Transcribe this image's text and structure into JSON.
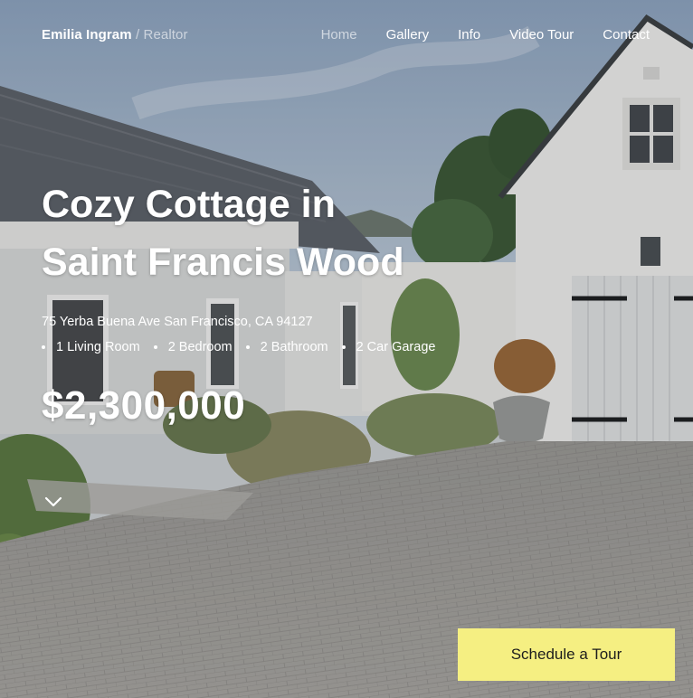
{
  "header": {
    "brand_name": "Emilia Ingram",
    "brand_separator": "/",
    "brand_role": "Realtor",
    "nav": [
      "Home",
      "Gallery",
      "Info",
      "Video Tour",
      "Contact"
    ],
    "active_nav": "Home"
  },
  "listing": {
    "title_line1": "Cozy Cottage in",
    "title_line2": "Saint Francis Wood",
    "address": "75 Yerba Buena Ave San Francisco, CA 94127",
    "features": [
      "1 Living Room",
      "2 Bedroom",
      "2 Bathroom",
      "2 Car Garage"
    ],
    "price": "$2,300,000"
  },
  "cta": {
    "label": "Schedule a Tour",
    "color": "#f5ef82"
  },
  "icons": {
    "scroll": "chevron-down-icon"
  }
}
